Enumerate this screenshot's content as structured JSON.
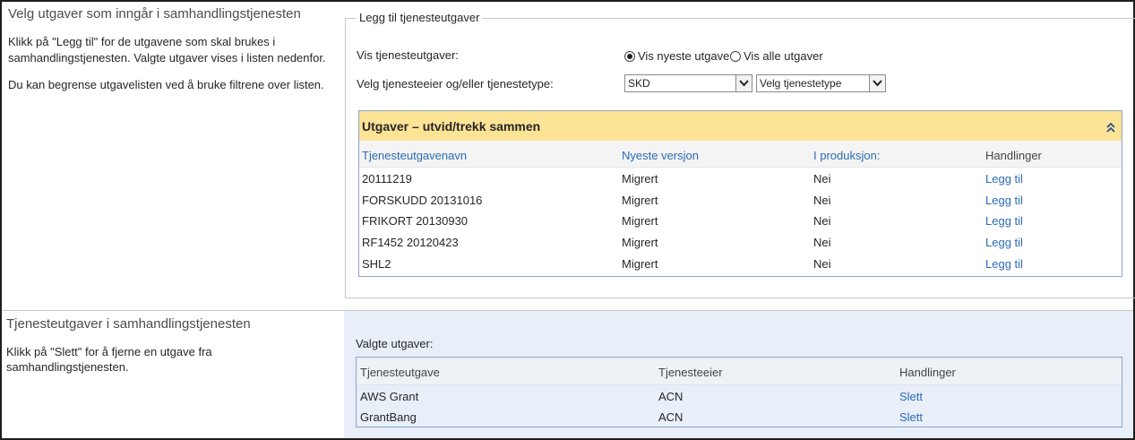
{
  "section1": {
    "title": "Velg utgaver som inngår i samhandlingstjenesten",
    "desc_line1": "Klikk på \"Legg til\" for de utgavene som skal brukes i",
    "desc_line2": "samhandlingstjenesten. Valgte utgaver vises i listen nedenfor.",
    "desc_line3": "Du kan begrense utgavelisten ved å bruke filtrene over listen."
  },
  "add_panel": {
    "legend": "Legg til tjenesteutgaver",
    "show_label": "Vis tjenesteutgaver:",
    "radio_newest": "Vis nyeste utgave",
    "radio_all": "Vis alle utgaver",
    "radio_selected": "newest",
    "filter_label": "Velg tjenesteeier og/eller tjenestetype:",
    "owner_select_value": "SKD",
    "type_select_value": "Velg tjenestetype"
  },
  "editions": {
    "header": "Utgaver – utvid/trekk sammen",
    "columns": [
      "Tjenesteutgavenavn",
      "Nyeste versjon",
      "I produksjon:",
      "Handlinger"
    ],
    "rows": [
      {
        "name": "20111219",
        "version": "Migrert",
        "production": "Nei",
        "action": "Legg til"
      },
      {
        "name": "FORSKUDD 20131016",
        "version": "Migrert",
        "production": "Nei",
        "action": "Legg til"
      },
      {
        "name": "FRIKORT 20130930",
        "version": "Migrert",
        "production": "Nei",
        "action": "Legg til"
      },
      {
        "name": "RF1452 20120423",
        "version": "Migrert",
        "production": "Nei",
        "action": "Legg til"
      },
      {
        "name": "SHL2",
        "version": "Migrert",
        "production": "Nei",
        "action": "Legg til"
      }
    ]
  },
  "section2": {
    "title": "Tjenesteutgaver i samhandlingstjenesten",
    "desc_line1": "Klikk på \"Slett\" for å fjerne en utgave fra",
    "desc_line2": "samhandlingstjenesten.",
    "selected_label": "Valgte utgaver:",
    "columns": [
      "Tjenesteutgave",
      "Tjenesteeier",
      "Handlinger"
    ],
    "rows": [
      {
        "edition": "AWS Grant",
        "owner": "ACN",
        "action": "Slett"
      },
      {
        "edition": "GrantBang",
        "owner": "ACN",
        "action": "Slett"
      }
    ]
  },
  "colors": {
    "accent_link": "#2c6bb5",
    "panel_header": "#fde396",
    "selected_bg": "#e8eff9"
  }
}
